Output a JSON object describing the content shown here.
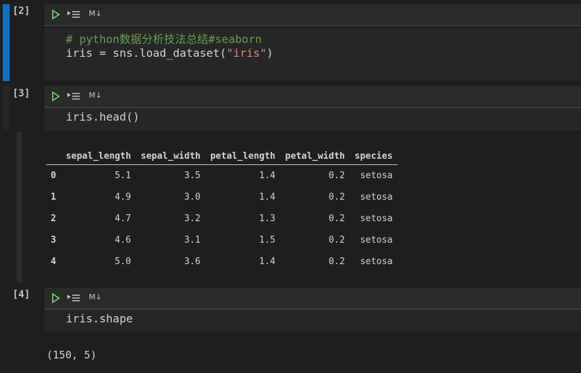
{
  "cells": [
    {
      "exec_count": "[2]",
      "md_label": "M↓",
      "code": {
        "comment": "# python数据分析技法总结#seaborn",
        "line2_prefix": "iris = sns.load_dataset(",
        "line2_string": "\"iris\"",
        "line2_suffix": ")"
      }
    },
    {
      "exec_count": "[3]",
      "md_label": "M↓",
      "code": "iris.head()",
      "output": {
        "columns": [
          "",
          "sepal_length",
          "sepal_width",
          "petal_length",
          "petal_width",
          "species"
        ],
        "rows": [
          [
            "0",
            "5.1",
            "3.5",
            "1.4",
            "0.2",
            "setosa"
          ],
          [
            "1",
            "4.9",
            "3.0",
            "1.4",
            "0.2",
            "setosa"
          ],
          [
            "2",
            "4.7",
            "3.2",
            "1.3",
            "0.2",
            "setosa"
          ],
          [
            "3",
            "4.6",
            "3.1",
            "1.5",
            "0.2",
            "setosa"
          ],
          [
            "4",
            "5.0",
            "3.6",
            "1.4",
            "0.2",
            "setosa"
          ]
        ]
      }
    },
    {
      "exec_count": "[4]",
      "md_label": "M↓",
      "code": "iris.shape",
      "output": "(150, 5)"
    }
  ],
  "colors": {
    "background": "#1e1e1e",
    "selected_bar": "#0e70c0",
    "comment": "#6a9955",
    "string": "#ce9178",
    "run_icon": "#89d185"
  }
}
